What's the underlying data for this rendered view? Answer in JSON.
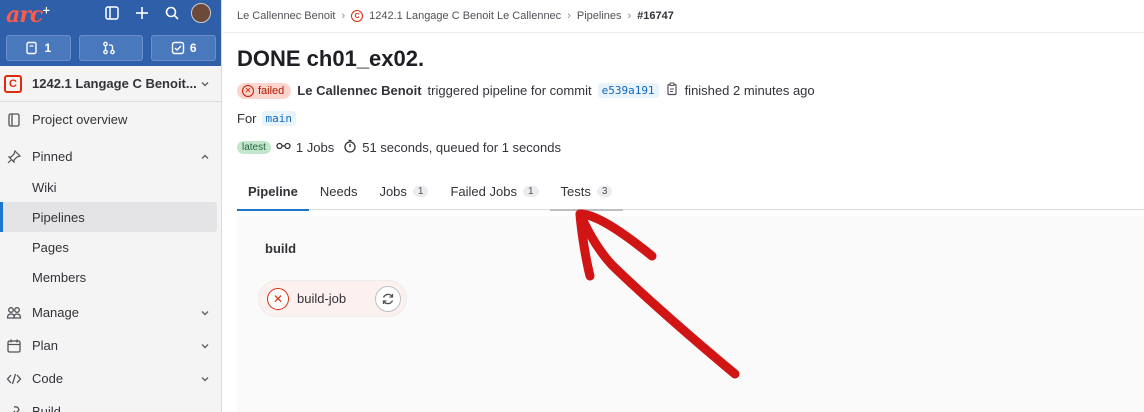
{
  "sidebar": {
    "logo_text": "arc",
    "counts": [
      {
        "icon": "issues-icon",
        "value": "1"
      },
      {
        "icon": "merge-request-icon",
        "value": ""
      },
      {
        "icon": "todo-icon",
        "value": "6"
      }
    ],
    "project": {
      "badge": "C",
      "name": "1242.1 Langage C Benoit..."
    },
    "items": [
      {
        "label": "Project overview",
        "icon": "overview-icon"
      },
      {
        "label": "Pinned",
        "icon": "pin-icon"
      },
      {
        "label": "Manage",
        "icon": "manage-icon"
      },
      {
        "label": "Plan",
        "icon": "plan-icon"
      },
      {
        "label": "Code",
        "icon": "code-icon"
      },
      {
        "label": "Build",
        "icon": "build-icon"
      }
    ],
    "pinned": [
      "Wiki",
      "Pipelines",
      "Pages",
      "Members"
    ]
  },
  "breadcrumb": [
    "Le Callennec Benoit",
    "1242.1 Langage C Benoit Le Callennec",
    "Pipelines",
    "#16747"
  ],
  "page": {
    "title": "DONE ch01_ex02.",
    "status": "failed",
    "author": "Le Callennec Benoit",
    "triggered_text": "triggered pipeline for commit",
    "commit": "e539a191",
    "finished": "finished 2 minutes ago",
    "for_label": "For",
    "branch": "main",
    "latest_badge": "latest",
    "jobs_text": "1 Jobs",
    "duration_text": "51 seconds, queued for 1 seconds"
  },
  "tabs": [
    {
      "label": "Pipeline",
      "count": ""
    },
    {
      "label": "Needs",
      "count": ""
    },
    {
      "label": "Jobs",
      "count": "1"
    },
    {
      "label": "Failed Jobs",
      "count": "1"
    },
    {
      "label": "Tests",
      "count": "3"
    }
  ],
  "pipeline": {
    "stage": "build",
    "job": "build-job"
  },
  "annotation_color": "#d11414"
}
